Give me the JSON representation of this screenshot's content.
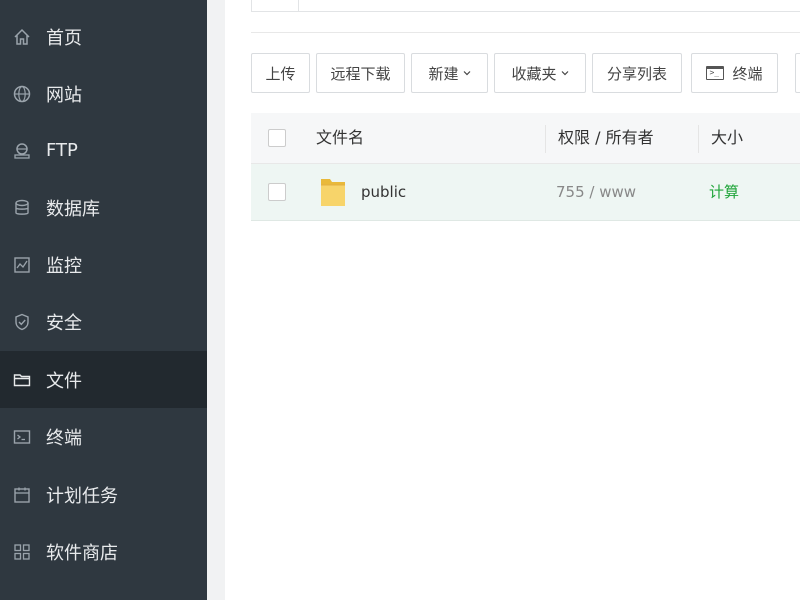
{
  "sidebar": {
    "items": [
      {
        "label": "首页",
        "icon": "home-icon"
      },
      {
        "label": "网站",
        "icon": "globe-icon"
      },
      {
        "label": "FTP",
        "icon": "ftp-icon"
      },
      {
        "label": "数据库",
        "icon": "database-icon"
      },
      {
        "label": "监控",
        "icon": "monitor-icon"
      },
      {
        "label": "安全",
        "icon": "shield-icon"
      },
      {
        "label": "文件",
        "icon": "folder-icon",
        "active": true
      },
      {
        "label": "终端",
        "icon": "terminal-icon"
      },
      {
        "label": "计划任务",
        "icon": "calendar-icon"
      },
      {
        "label": "软件商店",
        "icon": "apps-icon"
      }
    ]
  },
  "toolbar": {
    "upload": "上传",
    "remote_download": "远程下载",
    "new": "新建",
    "favorites": "收藏夹",
    "share_list": "分享列表",
    "terminal": "终端"
  },
  "table": {
    "headers": {
      "name": "文件名",
      "permission_owner": "权限 / 所有者",
      "size": "大小"
    },
    "rows": [
      {
        "name": "public",
        "permission": "755 / www",
        "size": "计算"
      }
    ]
  },
  "colors": {
    "sidebar_bg": "#2f3840",
    "sidebar_active_bg": "#22292f",
    "accent_green": "#20a53a",
    "row_highlight": "#eef6f3"
  }
}
